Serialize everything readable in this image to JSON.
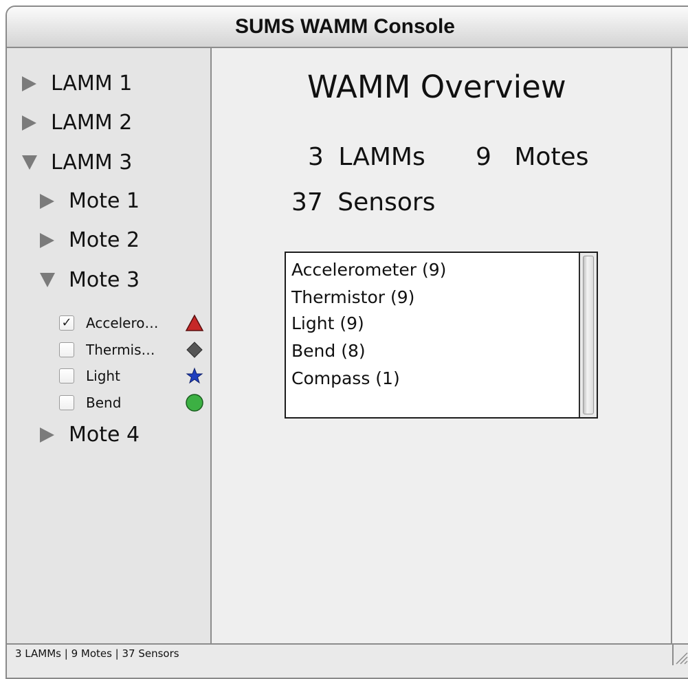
{
  "window": {
    "title": "SUMS WAMM Console"
  },
  "tree": {
    "lamms": [
      {
        "label": "LAMM 1",
        "expanded": false
      },
      {
        "label": "LAMM 2",
        "expanded": false
      },
      {
        "label": "LAMM 3",
        "expanded": true
      }
    ],
    "motes": [
      {
        "label": "Mote 1",
        "expanded": false
      },
      {
        "label": "Mote 2",
        "expanded": false
      },
      {
        "label": "Mote 3",
        "expanded": true
      },
      {
        "label": "Mote 4",
        "expanded": false
      }
    ],
    "sensors": [
      {
        "label": "Accelero…",
        "checked": true,
        "symbol": "red-triangle-icon",
        "color": "#c62828"
      },
      {
        "label": "Thermis…",
        "checked": false,
        "symbol": "gray-diamond-icon",
        "color": "#555555"
      },
      {
        "label": "Light",
        "checked": false,
        "symbol": "blue-star-icon",
        "color": "#1f3fbf"
      },
      {
        "label": "Bend",
        "checked": false,
        "symbol": "green-circle-icon",
        "color": "#3cb043"
      }
    ]
  },
  "overview": {
    "title": "WAMM Overview",
    "lamm_count": "3",
    "lamm_label": "LAMMs",
    "mote_count": "9",
    "mote_label": "Motes",
    "sensor_count": "37",
    "sensor_label": "Sensors",
    "sensor_types": [
      "Accelerometer (9)",
      "Thermistor (9)",
      "Light (9)",
      "Bend (8)",
      "Compass (1)"
    ]
  },
  "status": {
    "text": "3 LAMMs | 9 Motes | 37 Sensors"
  }
}
